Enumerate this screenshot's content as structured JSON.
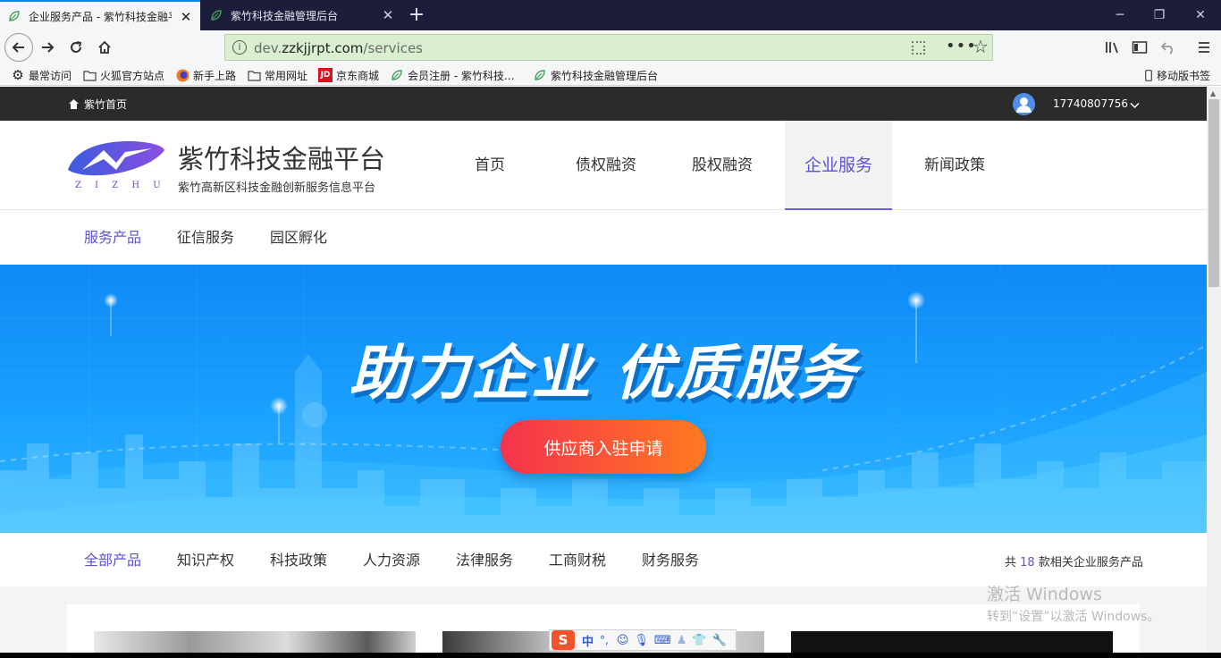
{
  "browser": {
    "tabs": [
      {
        "title": "企业服务产品 - 紫竹科技金融平台",
        "active": true
      },
      {
        "title": "紫竹科技金融管理后台",
        "active": false
      }
    ],
    "new_tab_symbol": "+",
    "url_prefix": "dev.",
    "url_domain": "zzkjjrpt.com",
    "url_path": "/services",
    "bookmarks": [
      {
        "label": "最常访问",
        "icon": "gear-icon"
      },
      {
        "label": "火狐官方站点",
        "icon": "folder-icon"
      },
      {
        "label": "新手上路",
        "icon": "firefox-icon"
      },
      {
        "label": "常用网址",
        "icon": "folder-icon"
      },
      {
        "label": "京东商城",
        "icon": "jd-icon"
      },
      {
        "label": "会员注册 - 紫竹科技...",
        "icon": "leaf-icon"
      },
      {
        "label": "紫竹科技金融管理后台",
        "icon": "leaf-icon"
      }
    ],
    "mobile_bookmarks": "移动版书签",
    "jd_logo_text": "JD"
  },
  "topbar": {
    "home_label": "紫竹首页",
    "phone": "17740807756"
  },
  "header": {
    "logo_letters": "Z I Z H U",
    "site_title": "紫竹科技金融平台",
    "site_subtitle": "紫竹高新区科技金融创新服务信息平台",
    "nav": [
      {
        "label": "首页",
        "active": false
      },
      {
        "label": "债权融资",
        "active": false
      },
      {
        "label": "股权融资",
        "active": false
      },
      {
        "label": "企业服务",
        "active": true
      },
      {
        "label": "新闻政策",
        "active": false
      }
    ]
  },
  "subnav": [
    {
      "label": "服务产品",
      "active": true
    },
    {
      "label": "征信服务",
      "active": false
    },
    {
      "label": "园区孵化",
      "active": false
    }
  ],
  "banner": {
    "headline": "助力企业 优质服务",
    "cta_label": "供应商入驻申请"
  },
  "categories": [
    {
      "label": "全部产品",
      "active": true
    },
    {
      "label": "知识产权",
      "active": false
    },
    {
      "label": "科技政策",
      "active": false
    },
    {
      "label": "人力资源",
      "active": false
    },
    {
      "label": "法律服务",
      "active": false
    },
    {
      "label": "工商财税",
      "active": false
    },
    {
      "label": "财务服务",
      "active": false
    }
  ],
  "count": {
    "prefix": "共",
    "number": "18",
    "suffix": "款相关企业服务产品"
  },
  "watermark": {
    "line1": "激活 Windows",
    "line2": "转到“设置”以激活 Windows。"
  },
  "ime": {
    "mode": "中",
    "punct": "°,"
  },
  "colors": {
    "accent": "#5a52d8",
    "cta_start": "#f5324d",
    "cta_end": "#ff7a20",
    "banner": "#1aa0ff"
  }
}
